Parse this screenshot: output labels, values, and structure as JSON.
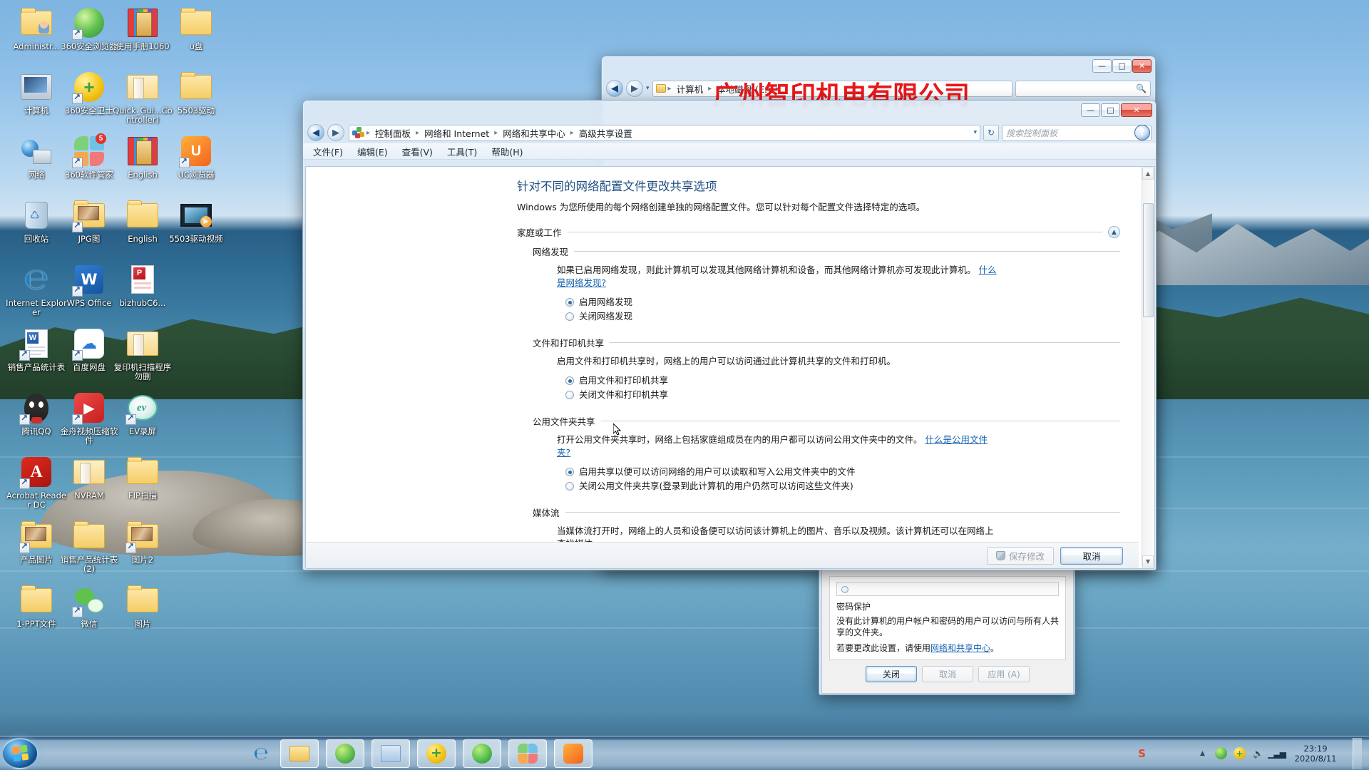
{
  "desktop": {
    "icons": [
      {
        "label": "Administr...",
        "type": "folder-user"
      },
      {
        "label": "360安全浏览器",
        "type": "app-360browser"
      },
      {
        "label": "使用手册1060",
        "type": "archive-rar"
      },
      {
        "label": "u盘",
        "type": "folder"
      },
      {
        "label": "计算机",
        "type": "computer"
      },
      {
        "label": "360安全卫士",
        "type": "app-360safe"
      },
      {
        "label": "Quick_Gui...Controller)",
        "type": "folder-open-doc"
      },
      {
        "label": "5503驱动",
        "type": "folder"
      },
      {
        "label": "网络",
        "type": "network"
      },
      {
        "label": "360软件管家",
        "type": "app-360soft"
      },
      {
        "label": "English",
        "type": "archive-rar"
      },
      {
        "label": "UC浏览器",
        "type": "app-uc"
      },
      {
        "label": "回收站",
        "type": "recycle-bin"
      },
      {
        "label": "JPG图",
        "type": "folder-pics"
      },
      {
        "label": "English",
        "type": "folder"
      },
      {
        "label": "5503驱动视频",
        "type": "video-file"
      },
      {
        "label": "Internet Explorer",
        "type": "app-ie"
      },
      {
        "label": "WPS Office",
        "type": "app-wps"
      },
      {
        "label": "bizhubC6...",
        "type": "file-pdfdoc"
      },
      {
        "label": "销售产品统计表",
        "type": "file-word"
      },
      {
        "label": "百度网盘",
        "type": "app-baidupan"
      },
      {
        "label": "复印机扫描程序勿删",
        "type": "folder-open"
      },
      {
        "label": "腾讯QQ",
        "type": "app-qq"
      },
      {
        "label": "金舟视频压缩软件",
        "type": "app-jinzhou"
      },
      {
        "label": "EV录屏",
        "type": "app-ev"
      },
      {
        "label": "Acrobat Reader DC",
        "type": "app-acrobat"
      },
      {
        "label": "NVRAM",
        "type": "folder-open"
      },
      {
        "label": "FIP扫描",
        "type": "folder"
      },
      {
        "label": "产品图片",
        "type": "folder-pics"
      },
      {
        "label": "销售产品统计表 (2)",
        "type": "folder"
      },
      {
        "label": "图片2",
        "type": "folder-pics"
      },
      {
        "label": "1-PPT文件",
        "type": "folder"
      },
      {
        "label": "微信",
        "type": "app-wechat"
      },
      {
        "label": "图片",
        "type": "folder"
      }
    ]
  },
  "explorer_window": {
    "breadcrumbs": [
      "计算机",
      "本地磁盘 (E:)"
    ],
    "buttons": {
      "minimize": "—",
      "maximize": "□",
      "close": "✕"
    },
    "watermark": "广州智印机电有限公司"
  },
  "control_panel": {
    "title_buttons": {
      "minimize": "—",
      "maximize": "□",
      "close": "✕"
    },
    "breadcrumbs": [
      "控制面板",
      "网络和 Internet",
      "网络和共享中心",
      "高级共享设置"
    ],
    "search": {
      "placeholder": "搜索控制面板",
      "icon": "search-icon"
    },
    "refresh_icon": "refresh-icon",
    "help_icon": "help-icon",
    "menu": [
      "文件(F)",
      "编辑(E)",
      "查看(V)",
      "工具(T)",
      "帮助(H)"
    ],
    "page_title": "针对不同的网络配置文件更改共享选项",
    "page_intro": "Windows 为您所使用的每个网络创建单独的网络配置文件。您可以针对每个配置文件选择特定的选项。",
    "profile_group": {
      "name": "家庭或工作",
      "collapse_icon": "chevron-up-icon"
    },
    "sections": [
      {
        "heading": "网络发现",
        "description": "如果已启用网络发现，则此计算机可以发现其他网络计算机和设备，而其他网络计算机亦可发现此计算机。",
        "link": "什么是网络发现?",
        "options": [
          {
            "label": "启用网络发现",
            "selected": true
          },
          {
            "label": "关闭网络发现",
            "selected": false
          }
        ]
      },
      {
        "heading": "文件和打印机共享",
        "description": "启用文件和打印机共享时，网络上的用户可以访问通过此计算机共享的文件和打印机。",
        "link": "",
        "options": [
          {
            "label": "启用文件和打印机共享",
            "selected": true
          },
          {
            "label": "关闭文件和打印机共享",
            "selected": false
          }
        ]
      },
      {
        "heading": "公用文件夹共享",
        "description": "打开公用文件夹共享时，网络上包括家庭组成员在内的用户都可以访问公用文件夹中的文件。",
        "link": "什么是公用文件夹?",
        "options": [
          {
            "label": "启用共享以便可以访问网络的用户可以读取和写入公用文件夹中的文件",
            "selected": true
          },
          {
            "label": "关闭公用文件夹共享(登录到此计算机的用户仍然可以访问这些文件夹)",
            "selected": false
          }
        ]
      },
      {
        "heading": "媒体流",
        "description": "当媒体流打开时，网络上的人员和设备便可以访问该计算机上的图片、音乐以及视频。该计算机还可以在网络上查找媒体。",
        "link": "",
        "options": []
      }
    ],
    "footer": {
      "save_label": "保存修改",
      "save_enabled": false,
      "save_shield_icon": "shield-icon",
      "cancel_label": "取消"
    },
    "scrollbar": {
      "up_arrow": "▲",
      "down_arrow": "▼"
    }
  },
  "sharing_dialog": {
    "password_section_title": "密码保护",
    "password_text_1": "没有此计算机的用户帐户和密码的用户可以访问与所有人共享的文件夹。",
    "password_text_2_prefix": "若要更改此设置，请使用",
    "password_text_2_link": "网络和共享中心",
    "password_text_2_suffix": "。",
    "buttons": [
      {
        "label": "关闭",
        "enabled": true,
        "focused": true
      },
      {
        "label": "取消",
        "enabled": false,
        "focused": false
      },
      {
        "label": "应用 (A)",
        "enabled": false,
        "focused": false
      }
    ]
  },
  "taskbar": {
    "start_tooltip": "开始",
    "quick_launch": [
      {
        "name": "ie-icon",
        "label": "Internet Explorer"
      },
      {
        "name": "explorer-icon",
        "label": "Windows 资源管理器"
      },
      {
        "name": "360-browser-icon",
        "label": "360安全浏览器"
      },
      {
        "name": "control-panel-icon",
        "label": "控制面板"
      },
      {
        "name": "360-safe-icon",
        "label": "360安全卫士"
      },
      {
        "name": "360-soft-icon",
        "label": "360软件管家"
      },
      {
        "name": "photos-icon",
        "label": "图片查看器"
      },
      {
        "name": "uc-browser-icon",
        "label": "UC浏览器"
      }
    ],
    "tray": {
      "sogou_icon": "sogou-input-icon",
      "overflow_icon": "show-hidden-icons",
      "icons": [
        "360-browser-tray-icon",
        "360-safe-tray-icon",
        "volume-icon",
        "network-signal-icon"
      ],
      "time": "23:19",
      "date": "2020/8/11"
    }
  }
}
